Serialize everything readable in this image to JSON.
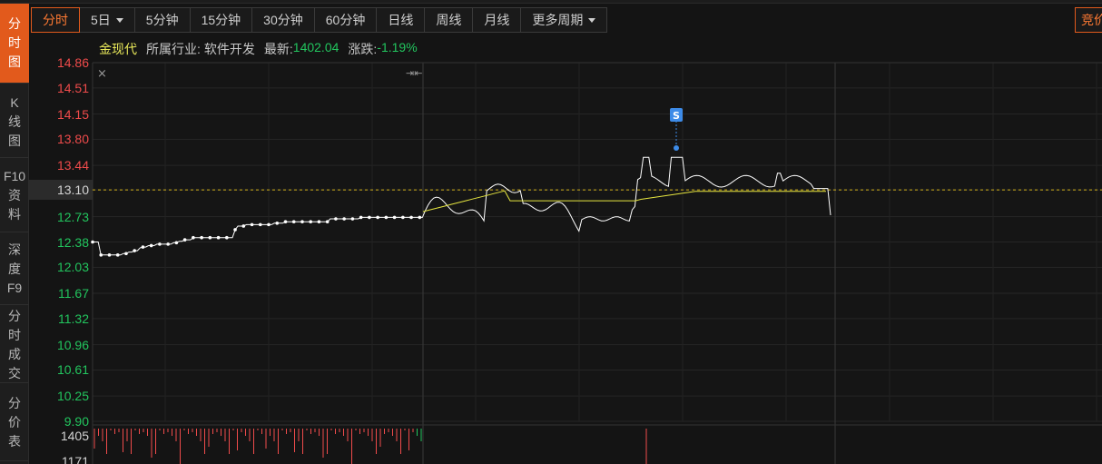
{
  "sidebar": {
    "tabs": [
      {
        "label": "分时图",
        "active": true
      },
      {
        "label": "K线图",
        "active": false
      },
      {
        "label": "F10资料",
        "active": false
      },
      {
        "label": "深度F9",
        "active": false
      },
      {
        "label": "分时成交",
        "active": false
      },
      {
        "label": "分价表",
        "active": false
      }
    ]
  },
  "periods": {
    "tabs": [
      {
        "label": "分时",
        "active": true,
        "dropdown": false
      },
      {
        "label": "5日",
        "active": false,
        "dropdown": true
      },
      {
        "label": "5分钟",
        "active": false,
        "dropdown": false
      },
      {
        "label": "15分钟",
        "active": false,
        "dropdown": false
      },
      {
        "label": "30分钟",
        "active": false,
        "dropdown": false
      },
      {
        "label": "60分钟",
        "active": false,
        "dropdown": false
      },
      {
        "label": "日线",
        "active": false,
        "dropdown": false
      },
      {
        "label": "周线",
        "active": false,
        "dropdown": false
      },
      {
        "label": "月线",
        "active": false,
        "dropdown": false
      },
      {
        "label": "更多周期",
        "active": false,
        "dropdown": true
      }
    ],
    "right_button": "竞价"
  },
  "info": {
    "name": "金现代",
    "industry_label": "所属行业:",
    "industry": "软件开发",
    "latest_label": "最新:",
    "latest": "1402.04",
    "change_label": "涨跌:",
    "change": "-1.19%"
  },
  "colors": {
    "up": "#ef4b4b",
    "down": "#22c55e",
    "price_line": "#ffffff",
    "avg_line": "#e6e640",
    "ref_line": "#d4b21a",
    "accent": "#e25a1c",
    "marker": "#3d8be8"
  },
  "chart_data": {
    "type": "line",
    "reference_price": 13.1,
    "reference_label": "13.10",
    "ylim": [
      9.9,
      14.86
    ],
    "price_ticks": [
      "14.86",
      "14.51",
      "14.15",
      "13.80",
      "13.44",
      "13.10",
      "12.73",
      "12.38",
      "12.03",
      "11.67",
      "11.32",
      "10.96",
      "10.61",
      "10.25",
      "9.90"
    ],
    "volume_ticks": [
      "1405",
      "1171"
    ],
    "volume_max": 1405,
    "marker_label": "S",
    "days": 5,
    "series": [
      {
        "role": "price",
        "values": [
          12.38,
          12.38,
          12.38,
          12.2,
          12.2,
          12.2,
          12.2,
          12.2,
          12.2,
          12.2,
          12.2,
          12.22,
          12.22,
          12.24,
          12.24,
          12.26,
          12.26,
          12.3,
          12.31,
          12.31,
          12.33,
          12.33,
          12.33,
          12.35,
          12.35,
          12.35,
          12.35,
          12.35,
          12.35,
          12.37,
          12.37,
          12.39,
          12.39,
          12.41,
          12.41,
          12.41,
          12.44,
          12.44,
          12.44,
          12.44,
          12.44,
          12.44,
          12.44,
          12.44,
          12.44,
          12.44,
          12.44,
          12.44,
          12.44,
          12.44,
          12.44,
          12.55,
          12.6,
          12.6,
          12.6,
          12.62,
          12.62,
          12.62,
          12.62,
          12.62,
          12.62,
          12.62,
          12.62,
          12.62,
          12.62,
          12.64,
          12.64,
          12.64,
          12.64,
          12.66,
          12.66,
          12.66,
          12.66,
          12.66,
          12.66,
          12.66,
          12.66,
          12.66,
          12.66,
          12.66,
          12.66,
          12.66,
          12.66,
          12.66,
          12.66,
          12.7,
          12.7,
          12.7,
          12.7,
          12.7,
          12.7,
          12.7,
          12.7,
          12.7,
          12.7,
          12.7,
          12.72,
          12.72,
          12.72,
          12.72,
          12.72,
          12.72,
          12.72,
          12.72,
          12.72,
          12.72,
          12.72,
          12.72,
          12.72,
          12.72,
          12.72,
          12.72,
          12.72,
          12.72,
          12.72,
          12.72,
          12.72,
          12.72,
          12.72,
          12.72,
          12.72,
          12.72,
          12.72,
          12.72,
          12.72,
          12.72,
          12.72,
          12.72,
          12.72,
          12.72,
          12.72,
          12.72,
          12.72,
          12.72,
          12.72,
          12.72,
          12.72,
          12.72,
          12.74,
          12.74,
          12.75,
          12.75,
          12.75,
          12.75,
          12.75,
          12.75,
          12.75,
          12.75,
          12.75,
          12.75,
          12.75,
          12.75,
          12.75,
          12.75,
          12.75,
          12.75,
          12.75,
          12.75,
          12.75,
          12.75,
          12.75,
          12.75,
          12.75,
          12.75,
          12.75,
          12.75,
          12.75,
          12.75,
          12.75,
          12.75,
          12.75,
          12.75,
          12.75,
          12.75,
          12.75,
          12.75,
          12.75,
          12.75,
          12.75,
          12.75,
          12.75,
          12.75,
          12.75,
          12.75,
          12.75,
          12.75,
          12.75,
          12.75,
          12.75,
          12.75,
          12.75,
          12.75,
          12.75,
          12.75,
          12.75,
          12.75,
          12.75,
          12.75,
          12.75,
          12.75,
          12.75,
          12.75,
          12.75,
          12.75,
          12.75,
          12.75,
          12.75,
          12.75,
          12.75,
          12.75,
          12.75,
          12.75,
          12.75,
          12.75,
          12.75,
          12.75,
          12.75,
          12.75,
          12.75,
          12.75,
          12.75,
          12.75,
          12.75,
          12.75,
          12.75,
          12.75,
          12.75,
          12.75,
          12.75,
          12.75,
          12.75,
          12.75,
          12.75,
          12.75,
          12.75,
          12.75,
          12.75,
          12.75,
          12.75,
          12.75,
          12.75,
          12.75,
          12.75,
          12.75,
          12.75,
          12.75,
          12.75,
          12.75,
          12.75,
          12.75,
          12.75,
          12.75,
          12.75,
          12.75,
          12.75,
          12.75,
          12.75,
          12.75,
          12.75,
          12.75,
          12.75,
          12.75,
          12.75,
          12.75,
          12.75
        ]
      }
    ]
  }
}
